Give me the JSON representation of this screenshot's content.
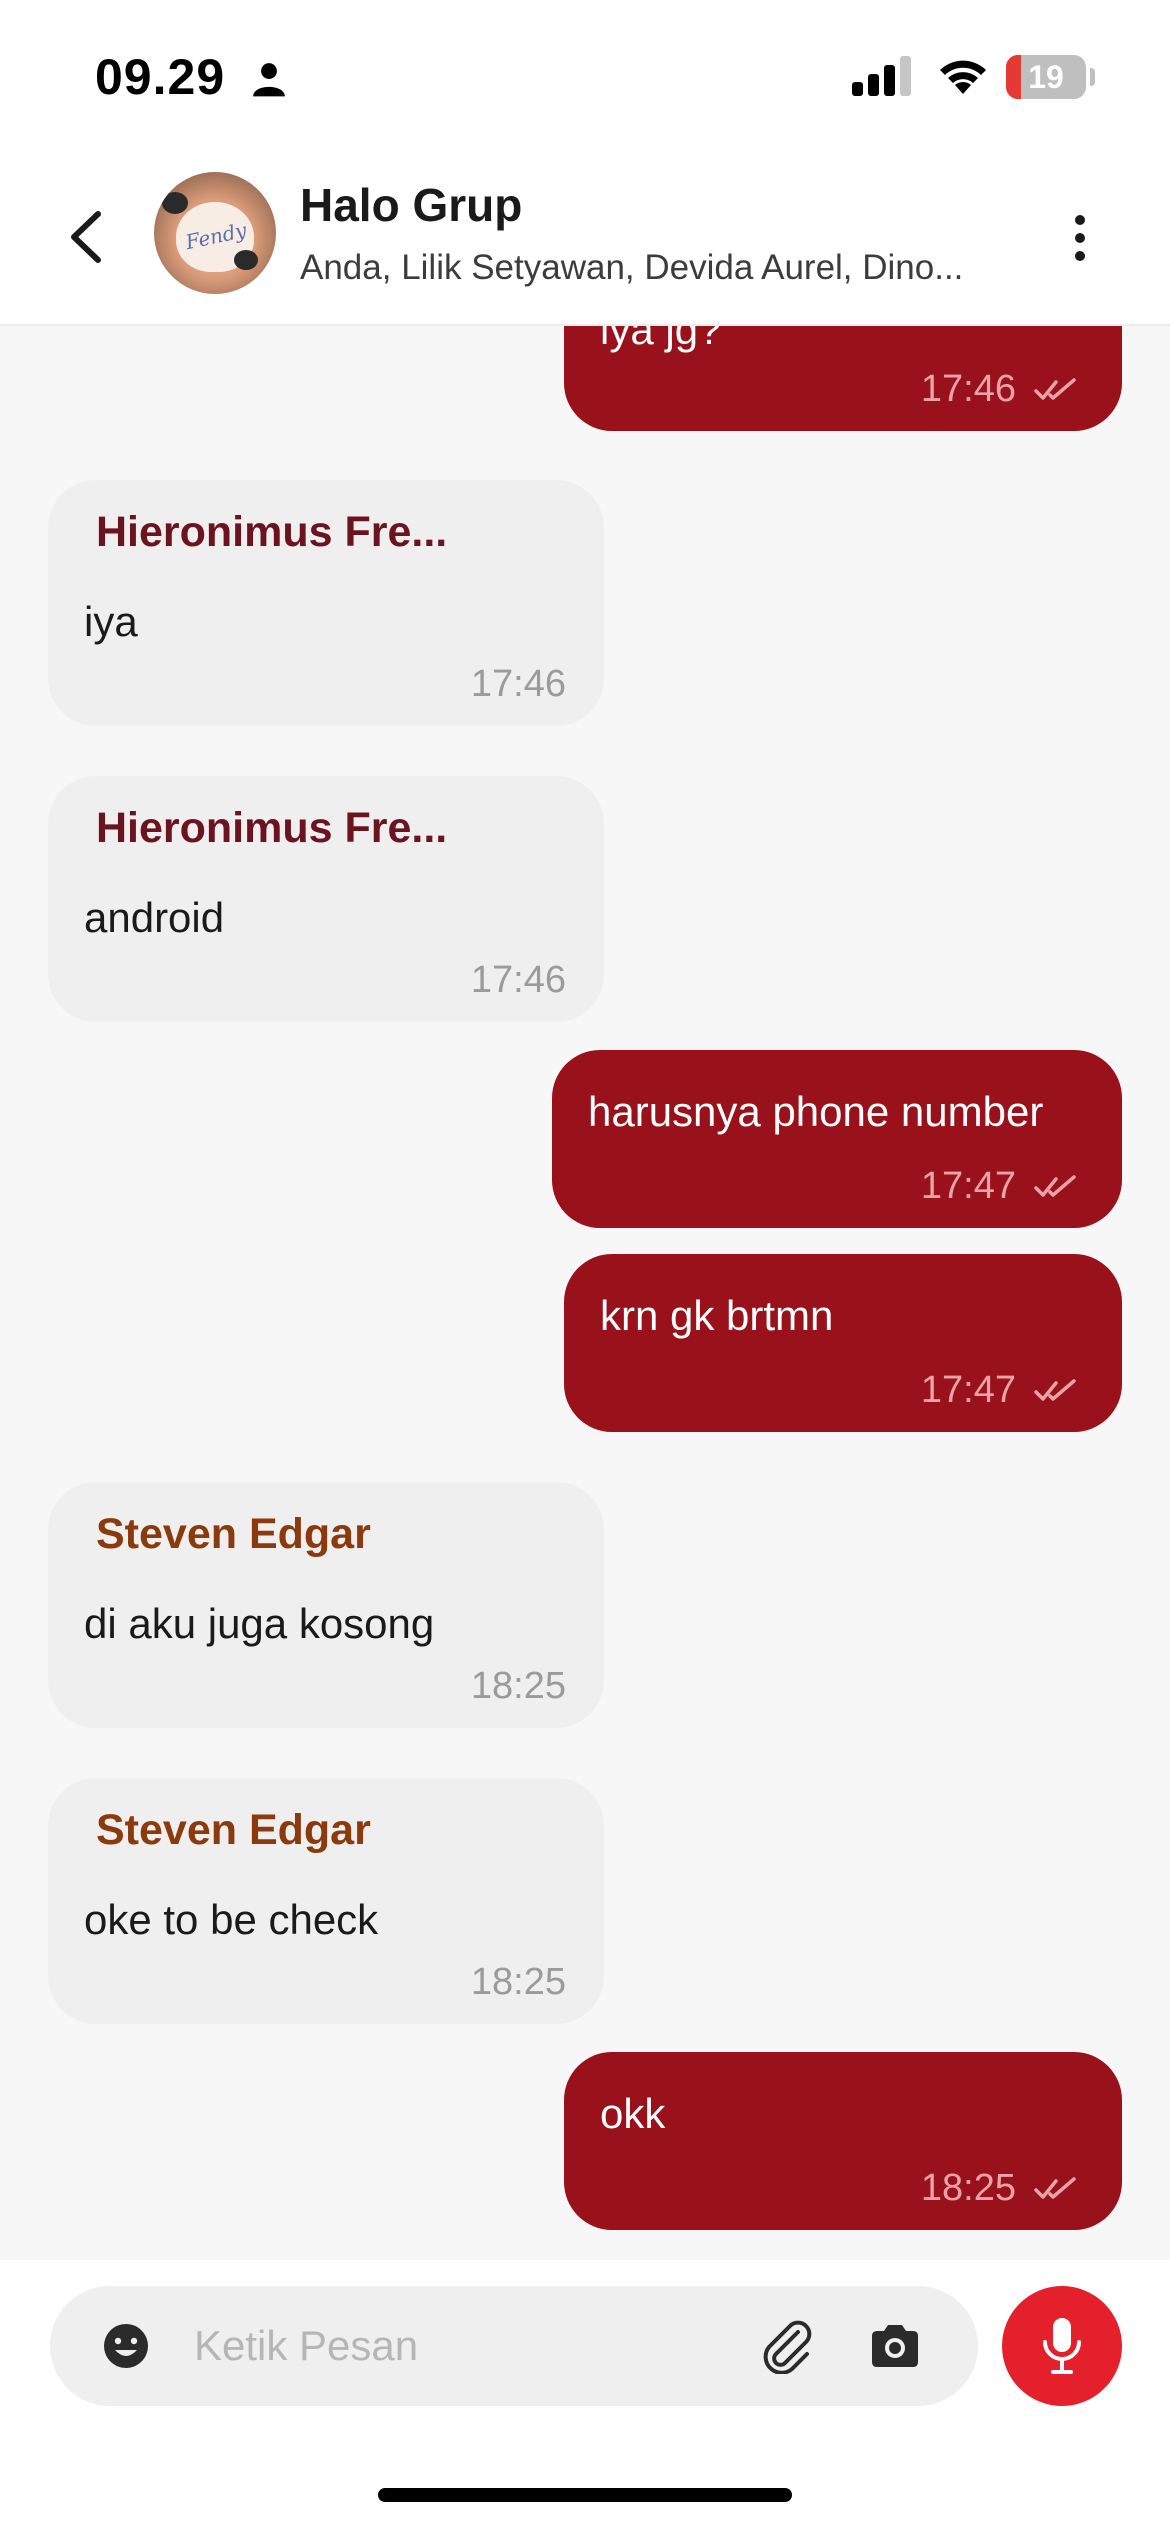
{
  "status_bar": {
    "time": "09.29",
    "battery_level": "19",
    "battery_fraction": 0.19
  },
  "header": {
    "title": "Halo Grup",
    "members": "Anda, Lilik Setyawan, Devida Aurel, Dino...",
    "avatar_text": "Fendy"
  },
  "colors": {
    "outgoing_bubble": "#99111a",
    "incoming_bubble": "#efefef",
    "sender_hieronimus": "#6b1420",
    "sender_steven": "#8a3a0c",
    "mic_button": "#e3202b"
  },
  "messages": [
    {
      "direction": "out",
      "text": "iya jg?",
      "time": "17:46",
      "read": true
    },
    {
      "direction": "in",
      "sender": "Hieronimus Fre...",
      "text": "iya",
      "time": "17:46"
    },
    {
      "direction": "in",
      "sender": "Hieronimus Fre...",
      "text": "android",
      "time": "17:46"
    },
    {
      "direction": "out",
      "text": "harusnya phone number",
      "time": "17:47",
      "read": true
    },
    {
      "direction": "out",
      "text": "krn gk brtmn",
      "time": "17:47",
      "read": true
    },
    {
      "direction": "in",
      "sender": "Steven Edgar",
      "text": "di aku juga kosong",
      "time": "18:25"
    },
    {
      "direction": "in",
      "sender": "Steven Edgar",
      "text": "oke to be check",
      "time": "18:25"
    },
    {
      "direction": "out",
      "text": "okk",
      "time": "18:25",
      "read": true
    }
  ],
  "composer": {
    "placeholder": "Ketik Pesan",
    "value": ""
  },
  "icons": {
    "back": "back-chevron-icon",
    "more": "more-vertical-icon",
    "emoji": "emoji-icon",
    "attach": "paperclip-icon",
    "camera": "camera-icon",
    "mic": "microphone-icon",
    "read_receipt": "double-check-icon"
  }
}
